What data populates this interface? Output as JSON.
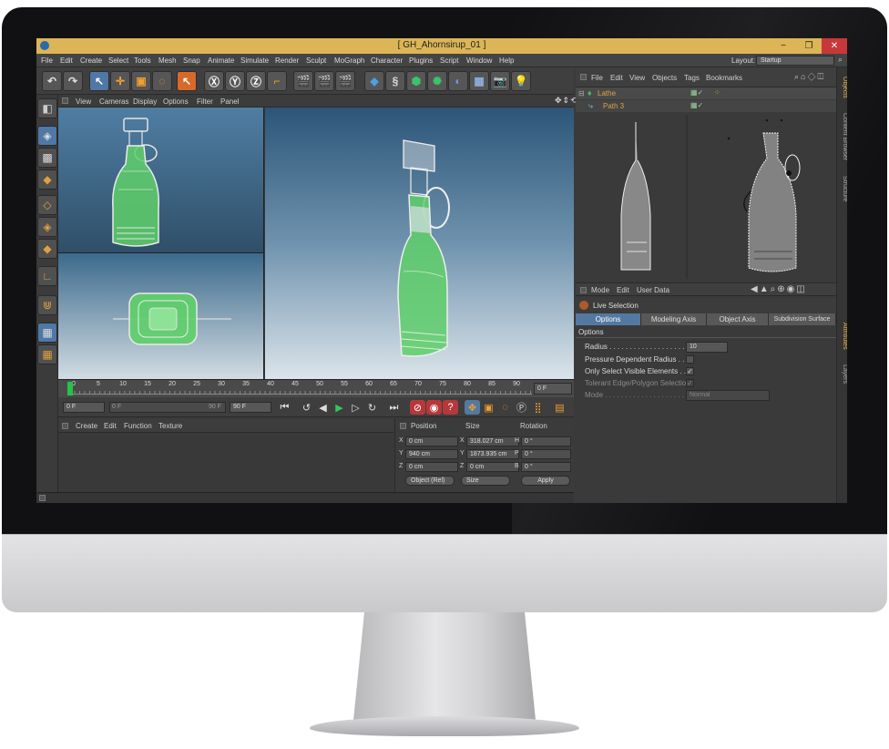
{
  "window": {
    "title": "[ GH_Ahornsirup_01 ]",
    "minimize": "−",
    "maximize": "❐",
    "close": "✕"
  },
  "menubar": {
    "items": [
      "File",
      "Edit",
      "Create",
      "Select",
      "Tools",
      "Mesh",
      "Snap",
      "Animate",
      "Simulate",
      "Render",
      "Sculpt",
      "MoGraph",
      "Character",
      "Plugins",
      "Script",
      "Window",
      "Help"
    ],
    "layout_label": "Layout:",
    "layout_value": "Startup"
  },
  "viewport": {
    "menu": [
      "View",
      "Cameras",
      "Display",
      "Options",
      "Filter",
      "Panel"
    ],
    "nav_icons": "✥⇕⟲◫"
  },
  "timeline": {
    "ticks": [
      "0",
      "5",
      "10",
      "15",
      "20",
      "25",
      "30",
      "35",
      "40",
      "45",
      "50",
      "55",
      "60",
      "65",
      "70",
      "75",
      "80",
      "85",
      "90"
    ],
    "current_frame": "0 F",
    "min_field": "0 F",
    "range_start": "0 F",
    "range_end": "90 F",
    "max_field": "90 F"
  },
  "material": {
    "menu": [
      "Create",
      "Edit",
      "Function",
      "Texture"
    ]
  },
  "coordinates": {
    "headers": [
      "Position",
      "Size",
      "Rotation"
    ],
    "rows": [
      {
        "axis": "X",
        "pos": "0 cm",
        "size_axis": "X",
        "size": "318.027 cm",
        "rot_axis": "H",
        "rot": "0 °"
      },
      {
        "axis": "Y",
        "pos": "940 cm",
        "size_axis": "Y",
        "size": "1873.935 cm",
        "rot_axis": "P",
        "rot": "0 °"
      },
      {
        "axis": "Z",
        "pos": "0 cm",
        "size_axis": "Z",
        "size": "0 cm",
        "rot_axis": "B",
        "rot": "0 °"
      }
    ],
    "mode_dropdown": "Object (Rel)",
    "size_dropdown": "Size",
    "apply": "Apply"
  },
  "objects": {
    "menu": [
      "File",
      "Edit",
      "View",
      "Objects",
      "Tags",
      "Bookmarks"
    ],
    "items": [
      {
        "name": "Lathe",
        "color": "#e0a040"
      },
      {
        "name": "Path 3",
        "color": "#e0a040"
      }
    ]
  },
  "attributes": {
    "menu": [
      "Mode",
      "Edit",
      "User Data"
    ],
    "mode": "Live Selection",
    "tabs": [
      "Options",
      "Modeling Axis",
      "Object Axis",
      "Subdivision Surface"
    ],
    "section": "Options",
    "radius_label": "Radius . . . . . . . . . . . . . . . . . . .",
    "radius_value": "10",
    "pressure_label": "Pressure Dependent Radius . . . .",
    "visible_label": "Only Select Visible Elements . . .",
    "tolerant_label": "Tolerant Edge/Polygon Selection",
    "mode_label": "Mode . . . . . . . . . . . . . . . . . . . . .",
    "mode_value": "Normal"
  },
  "side_tabs": [
    "Objects",
    "Content Browser",
    "Structure",
    "Attributes",
    "Layers"
  ],
  "colors": {
    "titlebar": "#dcb556",
    "accent_tab": "#5479a0",
    "close": "#c8373a",
    "bottle_green": "#5fcf6a"
  }
}
